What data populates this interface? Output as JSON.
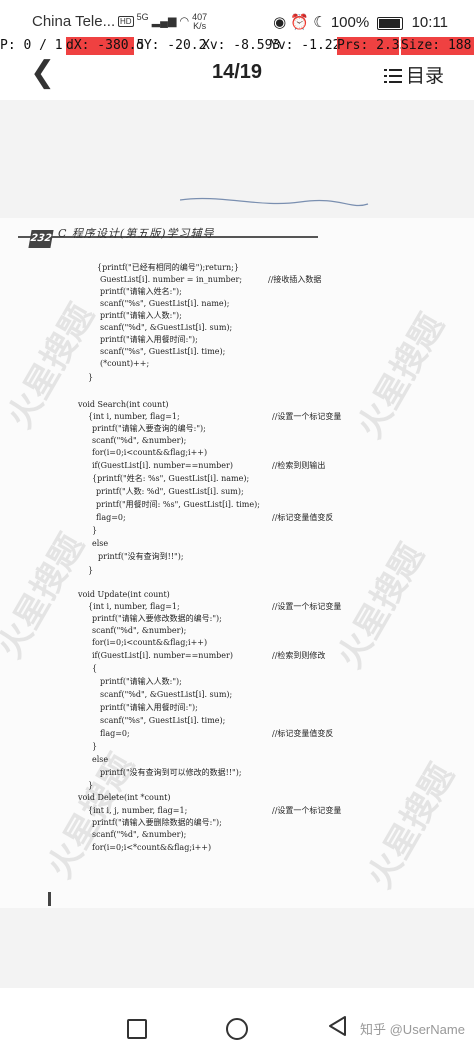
{
  "status_bar": {
    "carrier": "China Tele...",
    "hd": "HD",
    "signal": "5G",
    "speed_value": "407",
    "speed_unit": "K/s",
    "battery": "100%",
    "time": "10:11"
  },
  "debug_bar": {
    "p": "P: 0 / 1",
    "dx": "dX: -380.5",
    "dy": "dY: -20.2",
    "xv": "Xv: -8.593",
    "yv": "Yv: -1.227",
    "prs": "Prs: 2.33",
    "size": "Size: 188.0"
  },
  "nav": {
    "back_icon": "chevron-left-icon",
    "page_indicator": "14/19",
    "toc_icon": "list-icon",
    "toc_label": "目录"
  },
  "document": {
    "page_badge": "232",
    "book_title": "C 程序设计(第五版)学习辅导",
    "code_lines": [
      "{printf(\"已经有相同的编号\");return;}",
      "GuestList[i]. number = in_number;",
      "printf(\"请输入姓名:\");",
      "scanf(\"%s\", GuestList[i]. name);",
      "printf(\"请输入人数:\");",
      "scanf(\"%d\", &GuestList[i]. sum);",
      "printf(\"请输入用餐时间:\");",
      "scanf(\"%s\", GuestList[i]. time);",
      "(*count)++;",
      "}",
      "void Search(int count)",
      "{int i, number, flag=1;",
      "printf(\"请输入要查询的编号:\");",
      "scanf(\"%d\", &number);",
      "for(i=0;i<count&&flag;i++)",
      "if(GuestList[i]. number==number)",
      "{printf(\"姓名: %s\", GuestList[i]. name);",
      "printf(\"人数: %d\", GuestList[i]. sum);",
      "printf(\"用餐时间: %s\", GuestList[i]. time);",
      "flag=0;",
      "}",
      "else",
      "printf(\"没有查询到!!\");",
      "}",
      "void Update(int count)",
      "{int i, number, flag=1;",
      "printf(\"请输入要修改数据的编号:\");",
      "scanf(\"%d\", &number);",
      "for(i=0;i<count&&flag;i++)",
      "if(GuestList[i]. number==number)",
      "{",
      "printf(\"请输入人数:\");",
      "scanf(\"%d\", &GuestList[i]. sum);",
      "printf(\"请输入用餐时间:\");",
      "scanf(\"%s\", GuestList[i]. time);",
      "flag=0;",
      "}",
      "else",
      "printf(\"没有查询到可以修改的数据!!\");",
      "}",
      "void Delete(int *count)",
      "{int i, j, number, flag=1;",
      "printf(\"请输入要删除数据的编号:\");",
      "scanf(\"%d\", &number);",
      "for(i=0;i<*count&&flag;i++)"
    ],
    "comments": [
      "//接收插入数据",
      "//设置一个标记变量",
      "//检索到则输出",
      "//标记变量值变反",
      "//设置一个标记变量",
      "//检索到则修改",
      "//标记变量值变反",
      "//设置一个标记变量"
    ],
    "watermark_text": "火星搜题"
  },
  "bottom_bar": {
    "recent_icon": "square-icon",
    "home_icon": "circle-icon",
    "back_icon": "triangle-back-icon",
    "credit": "知乎 @UserName"
  }
}
